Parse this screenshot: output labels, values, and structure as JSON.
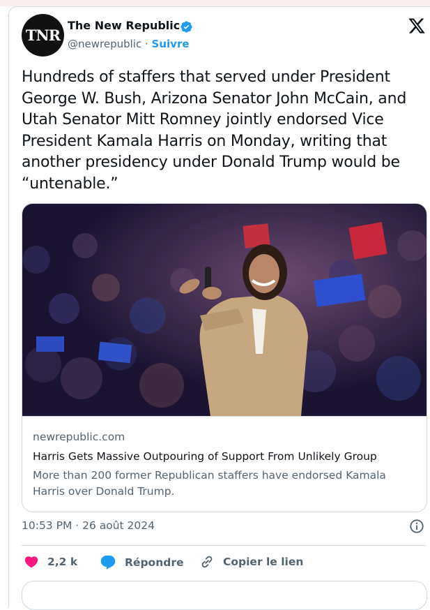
{
  "account": {
    "avatar_text": "TNR",
    "name": "The New Republic",
    "handle": "@newrepublic",
    "separator": "·",
    "follow_label": "Suivre"
  },
  "tweet": {
    "text": "Hundreds of staffers that served under President George W. Bush, Arizona Senator John McCain, and Utah Senator Mitt Romney jointly endorsed Vice President Kamala Harris on Monday, writing that another presidency under Donald Trump would be “untenable.”",
    "timestamp": "10:53 PM · 26 août 2024"
  },
  "link_card": {
    "domain": "newrepublic.com",
    "title": "Harris Gets Massive Outpouring of Support From Unlikely Group",
    "description": "More than 200 former Republican staffers have endorsed Kamala Harris over Donald Trump."
  },
  "actions": {
    "like_count": "2,2 k",
    "reply_label": "Répondre",
    "copy_link_label": "Copier le lien"
  },
  "colors": {
    "accent": "#1d9bf0",
    "like": "#f91880",
    "text": "#0f1419",
    "muted": "#536471",
    "border": "#cfd9de"
  },
  "icons": [
    "verified-badge-icon",
    "x-logo-icon",
    "info-icon",
    "heart-icon",
    "reply-icon",
    "link-icon"
  ]
}
